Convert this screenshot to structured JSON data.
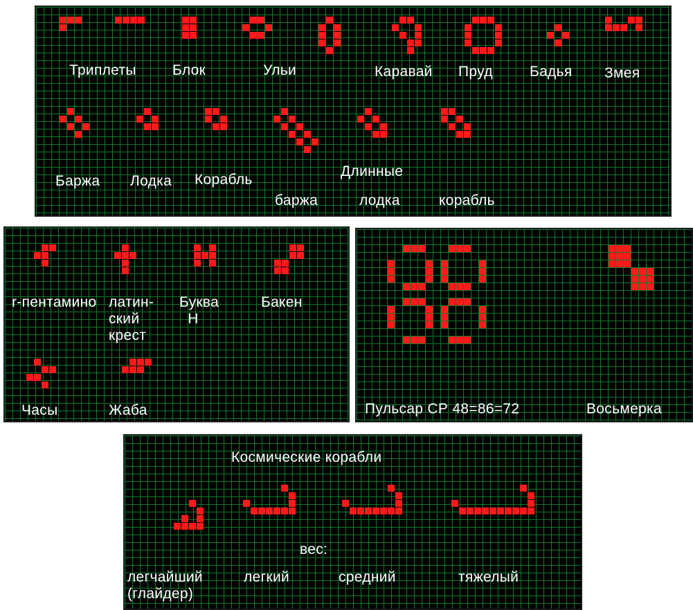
{
  "panels": {
    "still_lifes": {
      "labels": {
        "triplets": "Триплеты",
        "block": "Блок",
        "beehives": "Ульи",
        "loaf": "Каравай",
        "pond": "Пруд",
        "tub": "Бадья",
        "snake": "Змея",
        "barge": "Баржа",
        "boat": "Лодка",
        "ship": "Корабль",
        "long_header": "Длинные",
        "long_barge": "баржа",
        "long_boat": "лодка",
        "long_ship": "корабль"
      }
    },
    "oscillators": {
      "labels": {
        "r_pentomino": "r-пентамино",
        "latin_cross": "латин-\nский\nкрест",
        "letter_h": "Буква\n  Н",
        "beacon": "Бакен",
        "clock": "Часы",
        "toad": "Жаба"
      }
    },
    "period_oscillators": {
      "labels": {
        "pulsar": "Пульсар СР 48=86=72",
        "figure_eight": "Восьмерка"
      }
    },
    "spaceships": {
      "title": "Космические корабли",
      "weight_label": "вес:",
      "labels": {
        "lightest": "легчайший\n(глайдер)",
        "light": "легкий",
        "medium": "средний",
        "heavy": "тяжелый"
      }
    }
  },
  "colors": {
    "cell": "#ff1a1a",
    "grid": "#0d7a2e",
    "background": "#000000",
    "text": "#ffffff"
  }
}
